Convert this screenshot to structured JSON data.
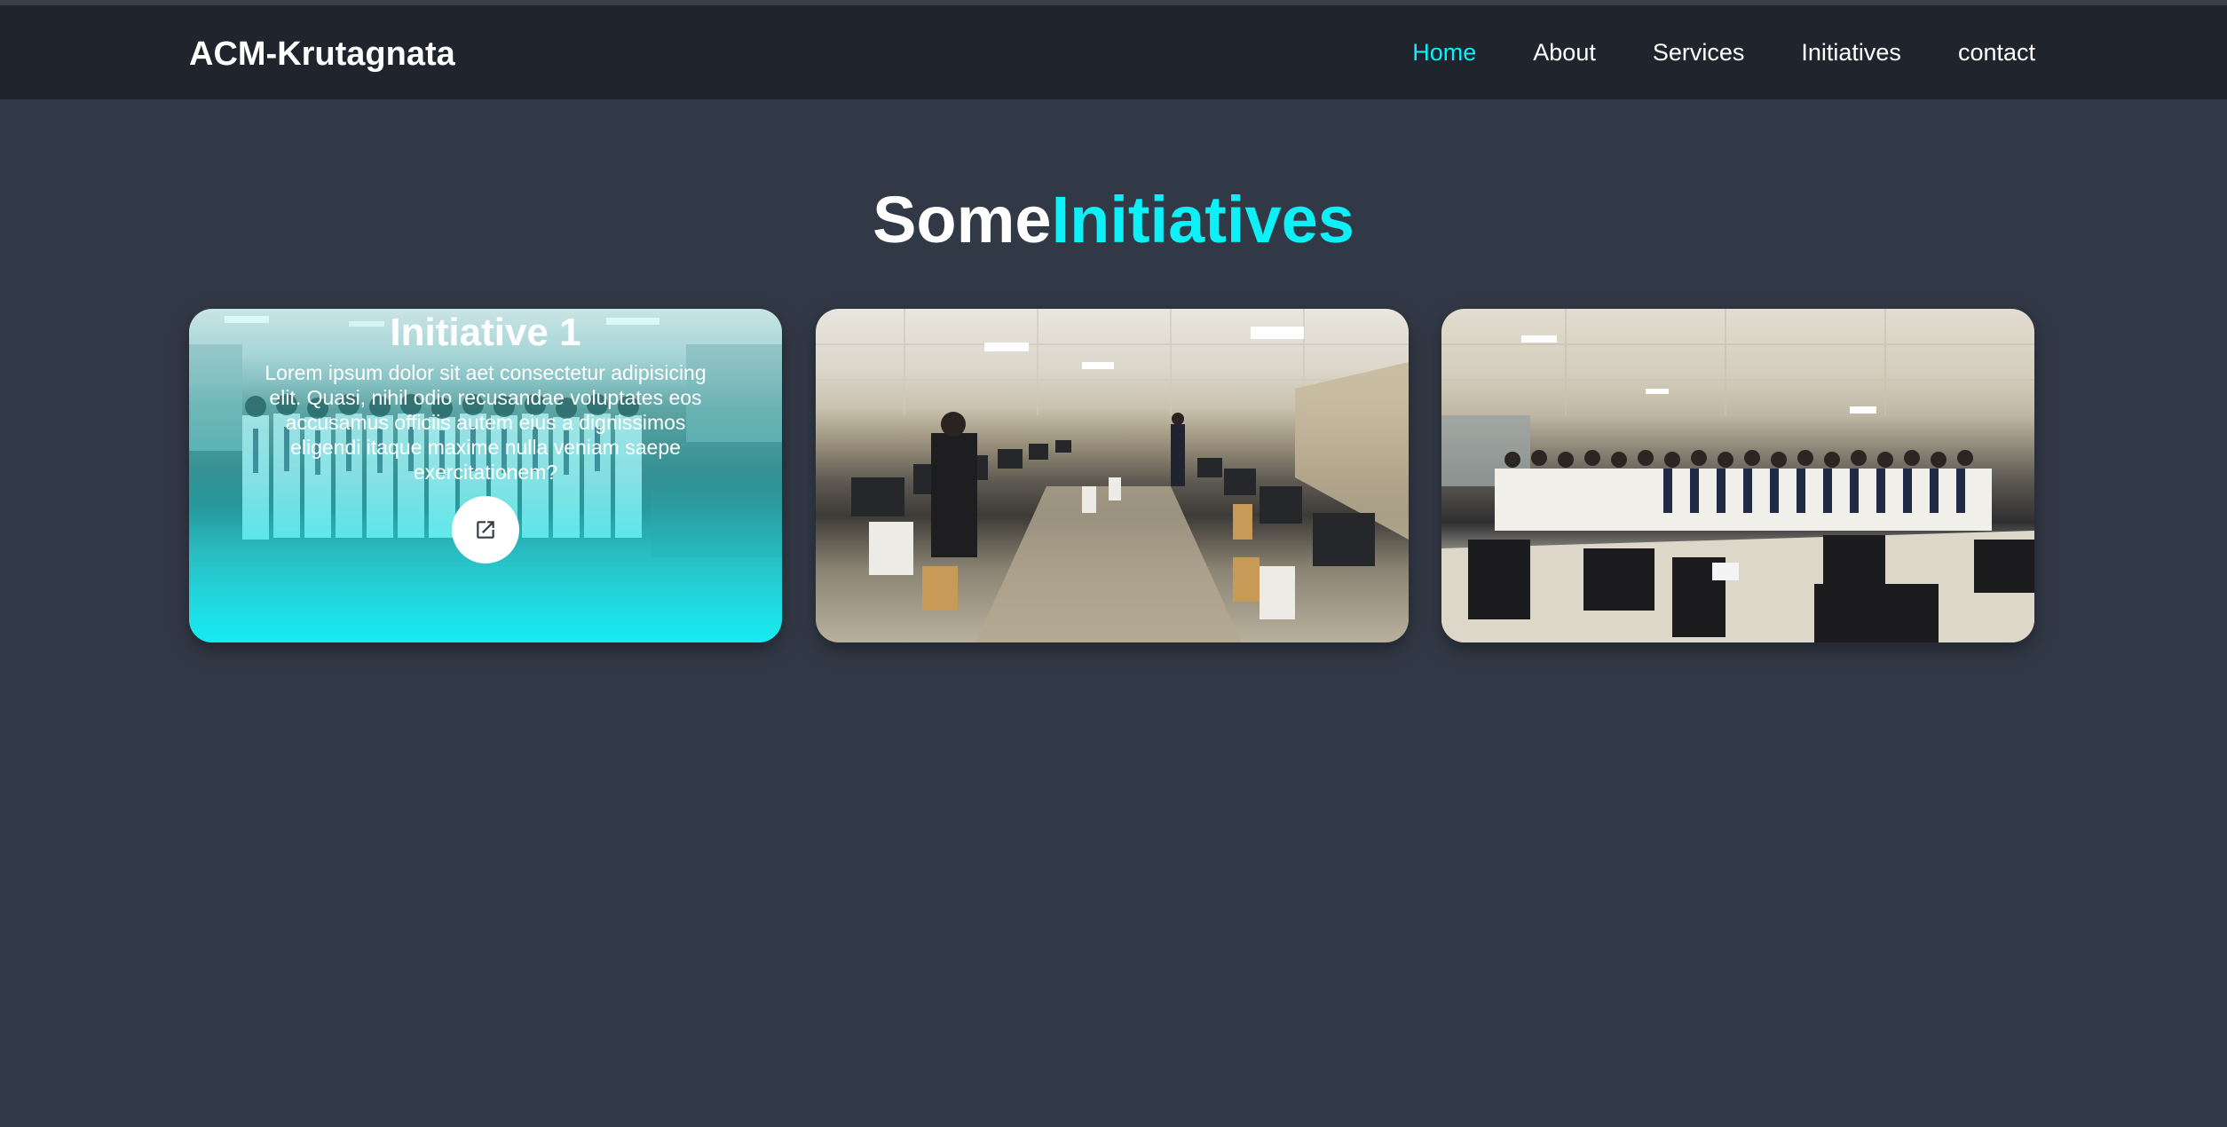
{
  "header": {
    "logo": "ACM-Krutagnata",
    "nav": [
      {
        "label": "Home",
        "active": true
      },
      {
        "label": "About",
        "active": false
      },
      {
        "label": "Services",
        "active": false
      },
      {
        "label": "Initiatives",
        "active": false
      },
      {
        "label": "contact",
        "active": false
      }
    ]
  },
  "section": {
    "title_part1": "Some",
    "title_part2": "Initiatives"
  },
  "cards": [
    {
      "title": "Initiative 1",
      "text": "Lorem ipsum dolor sit aet consectetur adipisicing elit. Quasi, nihil odio recusandae voluptates eos accusamus officiis autem eius a dignissimos eligendi itaque maxime nulla veniam saepe exercitationem?",
      "link_icon": "external-link-icon"
    }
  ],
  "colors": {
    "accent": "#0ef0f7",
    "background": "#323946",
    "header": "#1f242d"
  }
}
